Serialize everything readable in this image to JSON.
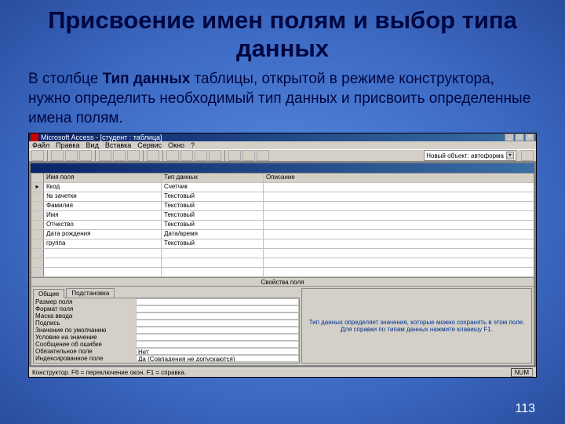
{
  "slide": {
    "title": "Присвоение имен полям и выбор типа данных",
    "body_prefix": "В столбце ",
    "body_bold": "Тип данных",
    "body_suffix": " таблицы, открытой в режиме конструктора, нужно определить необходимый тип данных и присвоить определенные имена полям.",
    "page_number": "113"
  },
  "app": {
    "title": "Microsoft Access - [студент : таблица]",
    "win_min": "_",
    "win_max": "□",
    "win_close": "×",
    "menu": [
      "Файл",
      "Правка",
      "Вид",
      "Вставка",
      "Сервис",
      "Окно",
      "?"
    ],
    "combo_label": "Новый объект: автоформа",
    "combo_drop": "▾",
    "inner_title": ""
  },
  "grid": {
    "head_name": "Имя поля",
    "head_type": "Тип данных",
    "head_desc": "Описание",
    "key_mark": "▸",
    "rows": [
      {
        "name": "Ккод",
        "type": "Счетчик"
      },
      {
        "name": "№ зачетки",
        "type": "Текстовый"
      },
      {
        "name": "Фамилия",
        "type": "Текстовый"
      },
      {
        "name": "Имя",
        "type": "Текстовый"
      },
      {
        "name": "Отчество",
        "type": "Текстовый"
      },
      {
        "name": "Дата рождения",
        "type": "Дата/время"
      },
      {
        "name": "группа",
        "type": "Текстовый"
      }
    ]
  },
  "props": {
    "section_label": "Свойства поля",
    "tab_general": "Общие",
    "tab_lookup": "Подстановка",
    "items": [
      {
        "label": "Размер поля",
        "value": ""
      },
      {
        "label": "Формат поля",
        "value": ""
      },
      {
        "label": "Маска ввода",
        "value": ""
      },
      {
        "label": "Подпись",
        "value": ""
      },
      {
        "label": "Значение по умолчанию",
        "value": ""
      },
      {
        "label": "Условие на значение",
        "value": ""
      },
      {
        "label": "Сообщение об ошибке",
        "value": ""
      },
      {
        "label": "Обязательное поле",
        "value": "Нет"
      },
      {
        "label": "Индексированное поле",
        "value": "Да (Совпадения не допускаются)"
      }
    ],
    "help_text": "Тип данных определяет значения, которые можно сохранять в этом поле. Для справки по типам данных нажмите клавишу F1."
  },
  "status": {
    "left": "Конструктор. F6 = переключение окон. F1 = справка.",
    "right": "NUM"
  }
}
